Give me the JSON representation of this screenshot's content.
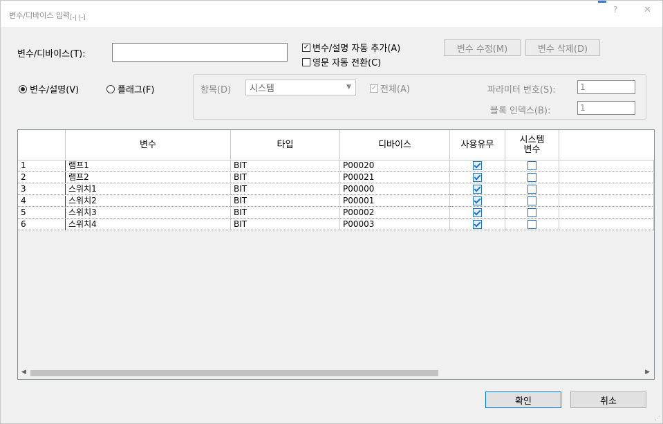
{
  "window": {
    "title": "변수/디바이스 입력",
    "title_suffix": "[-| |-]",
    "help_glyph": "?",
    "close_glyph": "✕"
  },
  "form": {
    "var_device_label": "변수/디바이스(T):",
    "var_device_value": "",
    "auto_add_label": "변수/설명 자동 추가(A)",
    "auto_add_checked": true,
    "english_auto_label": "영문 자동 전환(C)",
    "english_auto_checked": false,
    "edit_button": "변수 수정(M)",
    "delete_button": "변수 삭제(D)",
    "radio_var_label": "변수/설명(V)",
    "radio_flag_label": "플래그(F)",
    "radio_selected": "변수/설명(V)"
  },
  "filter": {
    "item_label": "항목(D)",
    "item_value": "시스템",
    "all_label": "전체(A)",
    "all_checked": true,
    "param_label": "파라미터 번호(S):",
    "param_value": "1",
    "block_label": "블록 인덱스(B):",
    "block_value": "1"
  },
  "grid": {
    "headers": [
      "",
      "변수",
      "타입",
      "디바이스",
      "사용유무",
      "시스템\n변수"
    ],
    "rows": [
      {
        "idx": "1",
        "var": "램프1",
        "type": "BIT",
        "device": "P00020",
        "use": true,
        "sys": false
      },
      {
        "idx": "2",
        "var": "램프2",
        "type": "BIT",
        "device": "P00021",
        "use": true,
        "sys": false
      },
      {
        "idx": "3",
        "var": "스위치1",
        "type": "BIT",
        "device": "P00000",
        "use": true,
        "sys": false
      },
      {
        "idx": "4",
        "var": "스위치2",
        "type": "BIT",
        "device": "P00001",
        "use": true,
        "sys": false
      },
      {
        "idx": "5",
        "var": "스위치3",
        "type": "BIT",
        "device": "P00002",
        "use": true,
        "sys": false
      },
      {
        "idx": "6",
        "var": "스위치4",
        "type": "BIT",
        "device": "P00003",
        "use": true,
        "sys": false
      }
    ]
  },
  "buttons": {
    "ok": "확인",
    "cancel": "취소"
  }
}
